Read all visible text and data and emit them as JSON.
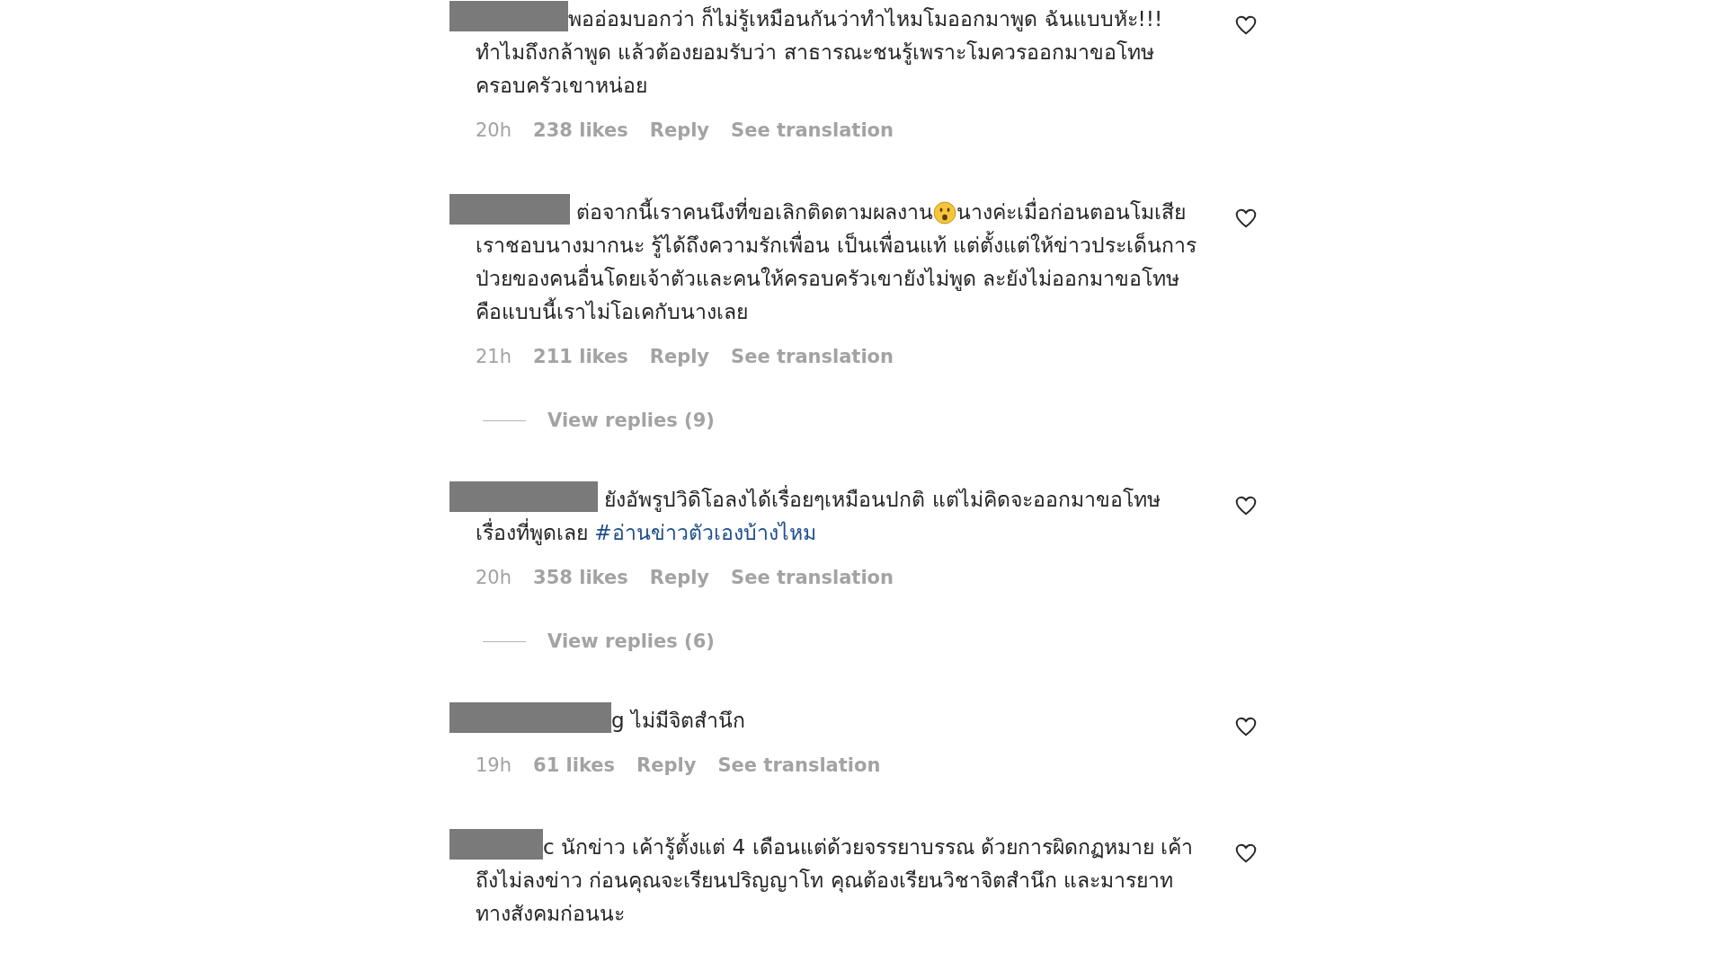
{
  "comments": [
    {
      "segments": [
        {
          "kind": "text",
          "text": "พออ่อมบอกว่า ก็ไม่รู้เหมือนกันว่าทำไหมโมออกมาพูด ฉันแบบหัะ!!! ทำไมถึงกล้าพูด แล้วต้องยอมรับว่า สาธารณะชนรู้เพราะโมควรออกมาขอโทษครอบครัวเขาหน่อย"
        }
      ],
      "time": "20h",
      "likes": "238 likes",
      "reply": "Reply",
      "translate": "See translation"
    },
    {
      "segments": [
        {
          "kind": "text",
          "text": " ต่อจากนี้เราคนนึงที่ขอเลิกติดตามผลงาน"
        },
        {
          "kind": "emoji"
        },
        {
          "kind": "text",
          "text": "นางค่ะเมื่อก่อนตอนโมเสีย เราชอบนางมากนะ รู้ได้ถึงความรักเพื่อน เป็นเพื่อนแท้ แต่ตั้งแต่ให้ข่าวประเด็นการป่วยของคนอื่นโดยเจ้าตัวและคนให้ครอบครัวเขายังไม่พูด ละยังไม่ออกมาขอโทษคือแบบนี้เราไม่โอเคกับนางเลย"
        }
      ],
      "time": "21h",
      "likes": "211 likes",
      "reply": "Reply",
      "translate": "See translation",
      "view_replies": "View replies (9)"
    },
    {
      "segments": [
        {
          "kind": "text",
          "text": " ยังอัพรูปวิดิโอลงได้เรื่อยๆเหมือนปกติ แต่ไม่คิดจะออกมาขอโทษเรื่องที่พูดเลย "
        },
        {
          "kind": "hashtag",
          "text": "#อ่านข่าวตัวเองบ้างไหม"
        }
      ],
      "time": "20h",
      "likes": "358 likes",
      "reply": "Reply",
      "translate": "See translation",
      "view_replies": "View replies (6)"
    },
    {
      "username_tail": "g",
      "segments": [
        {
          "kind": "text",
          "text": " ไม่มีจิตสำนึก"
        }
      ],
      "time": "19h",
      "likes": "61 likes",
      "reply": "Reply",
      "translate": "See translation"
    },
    {
      "username_tail": "c",
      "segments": [
        {
          "kind": "text",
          "text": " นักข่าว เค้ารู้ตั้งแต่ 4 เดือนแต่ด้วยจรรยาบรรณ ด้วยการผิดกฏหมาย เค้าถึงไม่ลงข่าว ก่อนคุณจะเรียนปริญญาโท คุณต้องเรียนวิชาจิตสำนึก และมารยาททางสังคมก่อนนะ"
        }
      ]
    }
  ]
}
